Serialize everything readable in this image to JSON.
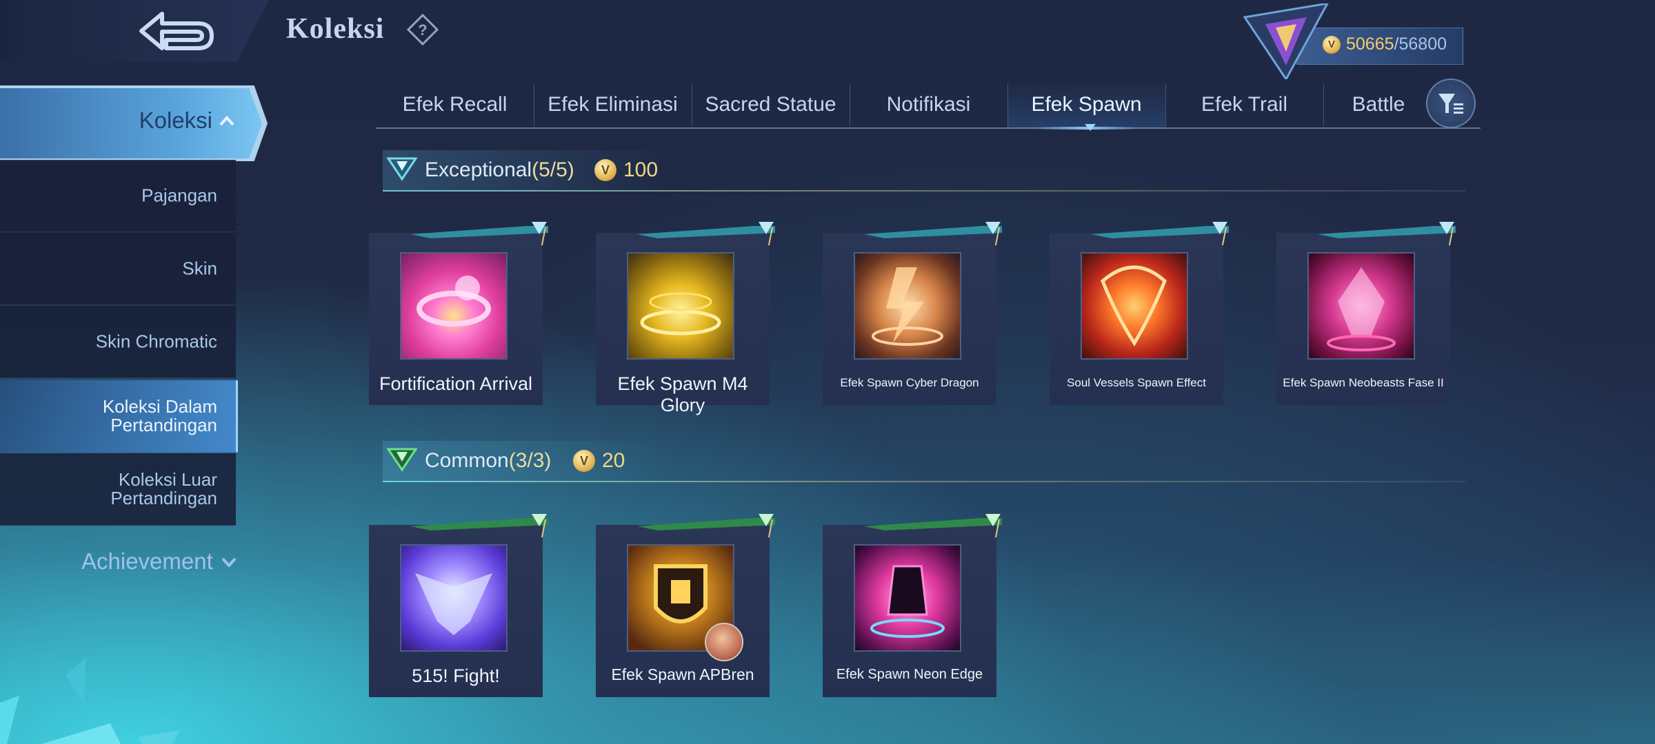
{
  "header": {
    "title": "Koleksi",
    "points_current": "50665",
    "points_separator": "/",
    "points_max": "56800"
  },
  "sidebar": {
    "main_label": "Koleksi",
    "items": [
      {
        "label": "Pajangan"
      },
      {
        "label": "Skin"
      },
      {
        "label": "Skin Chromatic"
      },
      {
        "label": "Koleksi Dalam Pertandingan",
        "active": true
      },
      {
        "label": "Koleksi Luar Pertandingan"
      }
    ],
    "achievement_label": "Achievement"
  },
  "tabs": [
    {
      "label": "Efek Recall"
    },
    {
      "label": "Efek Eliminasi"
    },
    {
      "label": "Sacred Statue"
    },
    {
      "label": "Notifikasi"
    },
    {
      "label": "Efek Spawn",
      "active": true
    },
    {
      "label": "Efek Trail"
    },
    {
      "label": "Battle"
    }
  ],
  "sections": [
    {
      "title": "Exceptional",
      "count": "(5/5)",
      "cost": "100",
      "items": [
        {
          "name": "Fortification Arrival"
        },
        {
          "name": "Efek Spawn M4 Glory"
        },
        {
          "name": "Efek Spawn Cyber Dragon"
        },
        {
          "name": "Soul Vessels Spawn Effect"
        },
        {
          "name": "Efek Spawn Neobeasts Fase II"
        }
      ]
    },
    {
      "title": "Common",
      "count": "(3/3)",
      "cost": "20",
      "items": [
        {
          "name": "515! Fight!"
        },
        {
          "name": "Efek Spawn APBren"
        },
        {
          "name": "Efek Spawn Neon Edge"
        }
      ]
    }
  ],
  "colors": {
    "accent_blue": "#7cc6f2",
    "gold": "#f3cd6a",
    "background": "#202a46"
  },
  "icons": [
    "back-arrow-icon",
    "help-icon",
    "rank-emblem-icon",
    "coin-icon",
    "chevron-up-icon",
    "chevron-down-icon",
    "filter-icon",
    "tier-badge-icon"
  ]
}
